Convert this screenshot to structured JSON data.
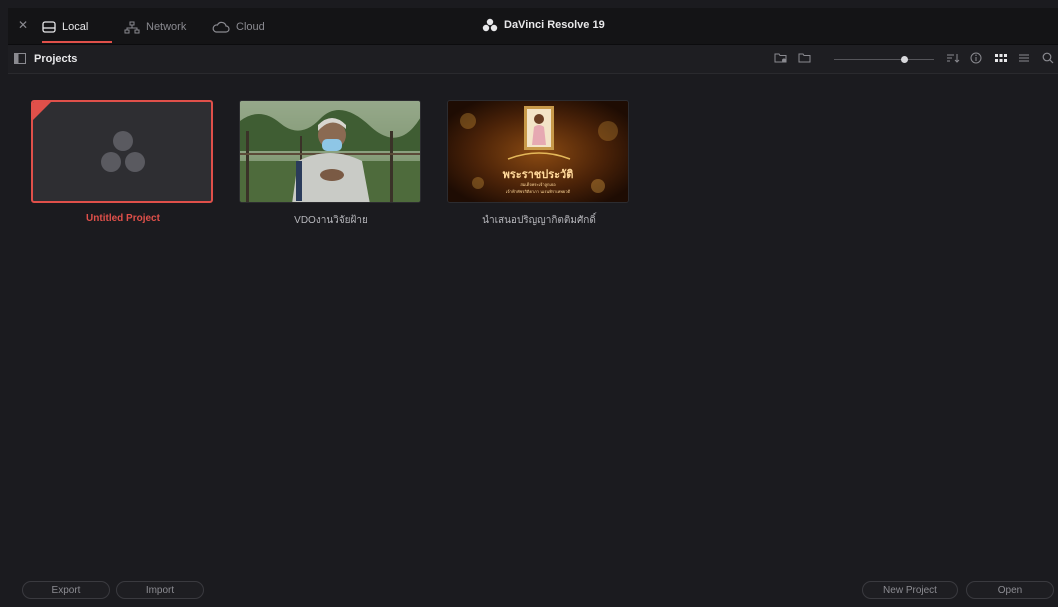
{
  "app": {
    "title": "DaVinci Resolve 19"
  },
  "tabs": [
    {
      "label": "Local"
    },
    {
      "label": "Network"
    },
    {
      "label": "Cloud"
    }
  ],
  "toolbar": {
    "section_title": "Projects"
  },
  "projects": [
    {
      "name": "Untitled Project",
      "selected": true
    },
    {
      "name": "VDOงานวิจัยฝ้าย",
      "selected": false
    },
    {
      "name": "นำเสนอปริญญากิตติมศักดิ์",
      "selected": false,
      "thumb_title": "พระราชประวัติ",
      "thumb_sub1": "สมเด็จพระเจ้าลูกเธอ",
      "thumb_sub2": "เจ้าฟ้าพัชรกิติยาภา นเรนทิราเทพยวดี"
    }
  ],
  "footer": {
    "export": "Export",
    "import": "Import",
    "new_project": "New Project",
    "open": "Open"
  },
  "colors": {
    "accent": "#e0504a",
    "background": "#1b1b1f"
  }
}
